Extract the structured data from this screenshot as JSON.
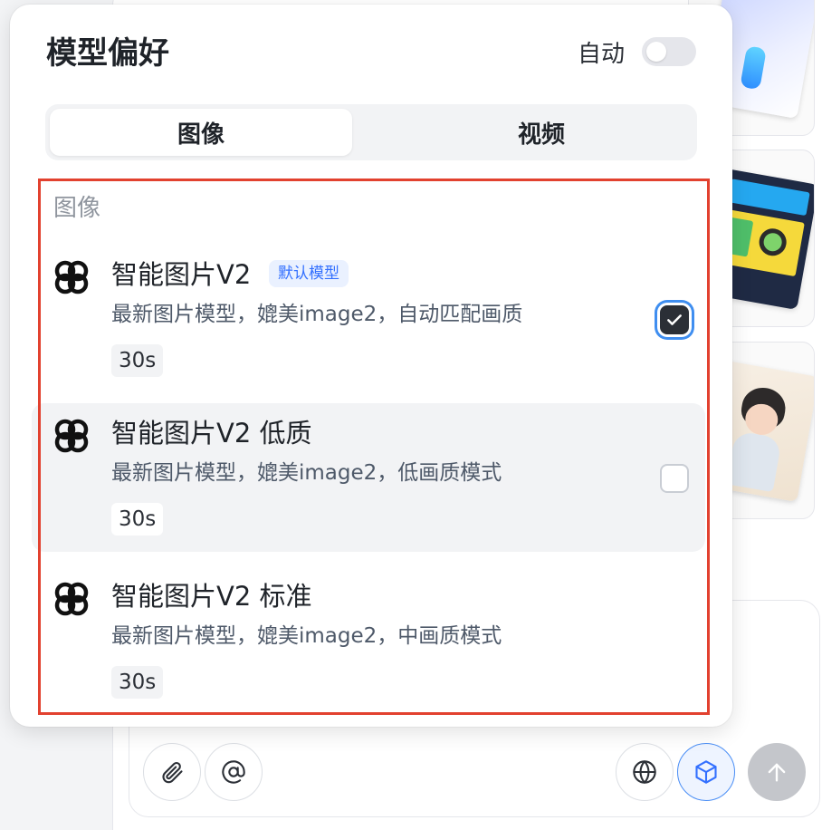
{
  "popover": {
    "title": "模型偏好",
    "auto_label": "自动",
    "auto_enabled": false,
    "tabs": [
      {
        "label": "图像",
        "active": true
      },
      {
        "label": "视频",
        "active": false
      }
    ],
    "section_label": "图像",
    "models": [
      {
        "name": "智能图片V2",
        "badge": "默认模型",
        "description": "最新图片模型，媲美image2，自动匹配画质",
        "time": "30s",
        "checked": true,
        "icon": "model-logo-icon"
      },
      {
        "name": "智能图片V2 低质",
        "description": "最新图片模型，媲美image2，低画质模式",
        "time": "30s",
        "checked": false,
        "hovered": true,
        "icon": "model-logo-icon"
      },
      {
        "name": "智能图片V2 标准",
        "description": "最新图片模型，媲美image2，中画质模式",
        "time": "30s",
        "checked": false,
        "icon": "model-logo-icon"
      }
    ]
  },
  "composer": {
    "buttons": [
      {
        "icon": "paperclip-icon"
      },
      {
        "icon": "at-sign-icon"
      },
      {
        "icon": "globe-icon"
      },
      {
        "icon": "cube-icon",
        "active": true
      },
      {
        "icon": "arrow-up-icon",
        "disabled": true
      }
    ]
  },
  "colors": {
    "highlight_border": "#e2412f",
    "badge_text": "#3370ff",
    "badge_bg": "#eaf1ff",
    "checkbox_checked": "#2b2f36",
    "focus_ring": "#3f8ef0"
  }
}
